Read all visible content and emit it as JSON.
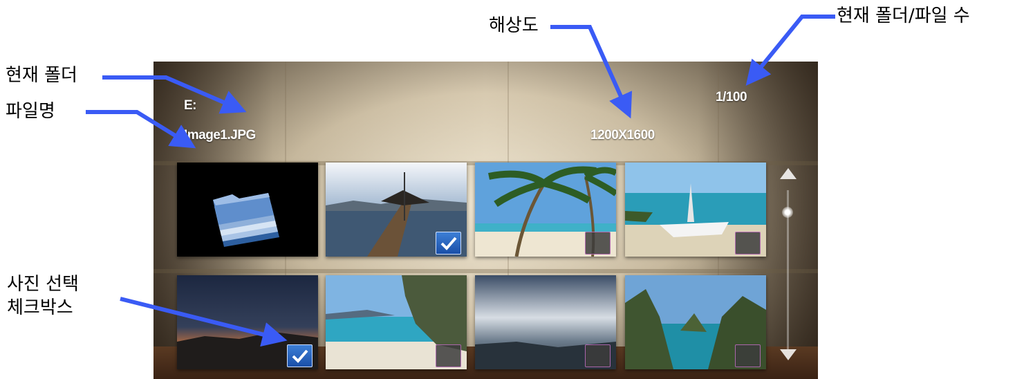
{
  "annotations": {
    "current_folder": "현재 폴더",
    "file_name": "파일명",
    "resolution": "해상도",
    "folder_file_count": "현재 폴더/파일 수",
    "photo_checkbox_line1": "사진 선택",
    "photo_checkbox_line2": "체크박스"
  },
  "viewer": {
    "folder": "E:",
    "file_name": "Image1.JPG",
    "resolution": "1200X1600",
    "count": "1/100"
  },
  "thumbnails": [
    {
      "kind": "folder-icon",
      "checked": null
    },
    {
      "kind": "pier",
      "checked": true
    },
    {
      "kind": "palm-beach",
      "checked": false
    },
    {
      "kind": "boat-beach",
      "checked": false
    },
    {
      "kind": "sunset",
      "checked": true
    },
    {
      "kind": "cliff-beach",
      "checked": false
    },
    {
      "kind": "clouds-sea",
      "checked": false
    },
    {
      "kind": "lagoon",
      "checked": false
    }
  ],
  "colors": {
    "arrow": "#3a5bf5",
    "checkbox_on": "#2a63c4",
    "hud_text": "#ffffff"
  },
  "icons": [
    "folder-icon",
    "checkmark-icon",
    "scroll-up-icon",
    "scroll-down-icon"
  ]
}
